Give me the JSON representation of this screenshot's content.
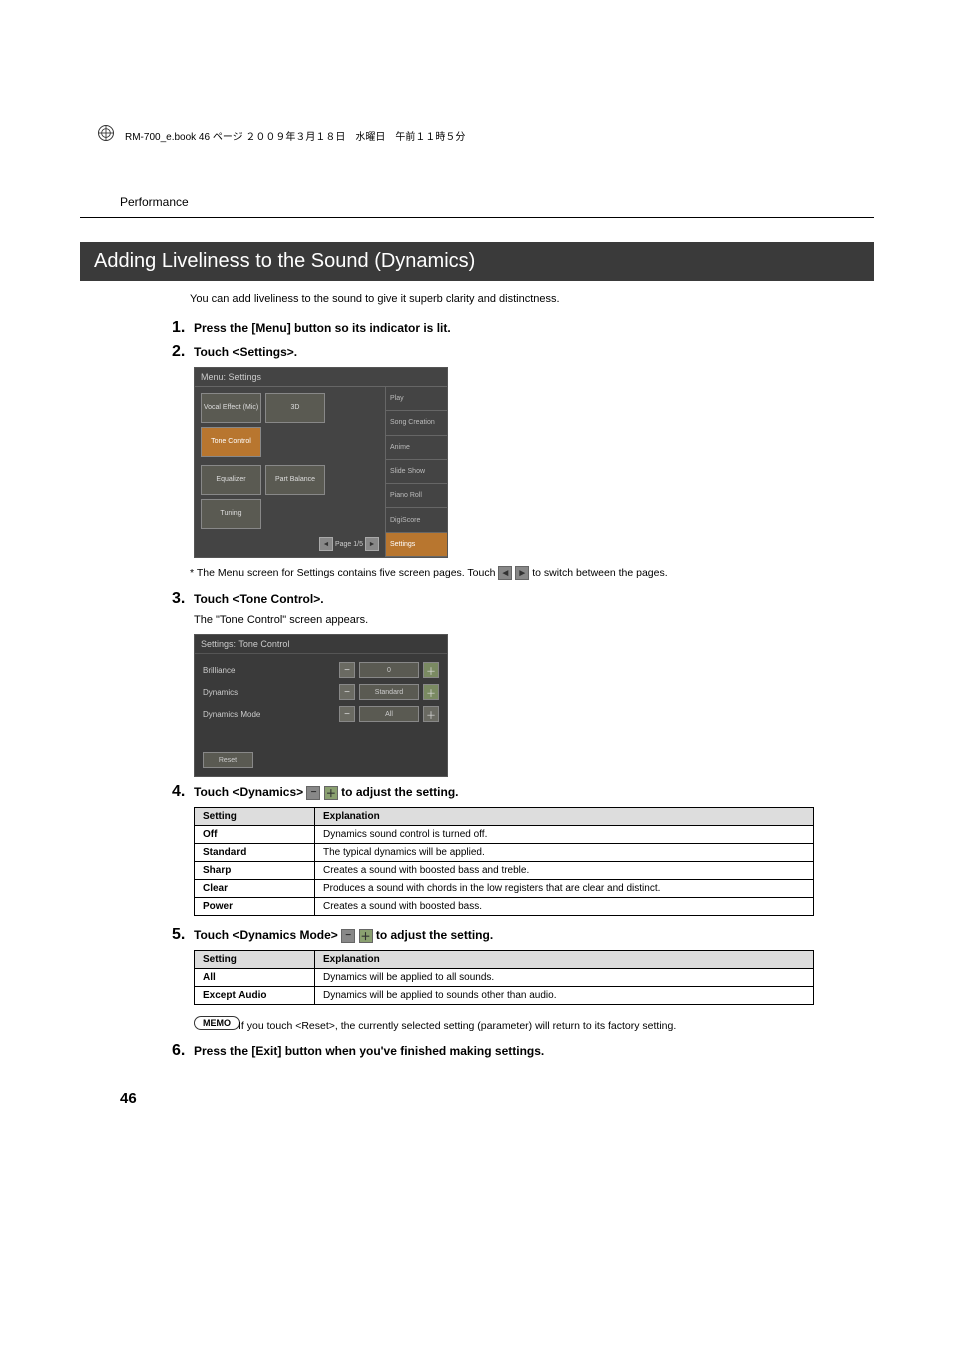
{
  "header_line": "RM-700_e.book  46 ページ  ２００９年３月１８日　水曜日　午前１１時５分",
  "section_label": "Performance",
  "title": "Adding Liveliness to the Sound (Dynamics)",
  "intro": "You can add liveliness to the sound to give it superb clarity and distinctness.",
  "steps": {
    "s1": {
      "num": "1.",
      "text": "Press the [Menu] button so its indicator is lit."
    },
    "s2": {
      "num": "2.",
      "text": "Touch <Settings>."
    },
    "s3": {
      "num": "3.",
      "text": "Touch <Tone Control>."
    },
    "s4": {
      "num": "4.",
      "pre": "Touch <Dynamics> ",
      "post": " to adjust the setting."
    },
    "s5": {
      "num": "5.",
      "pre": "Touch <Dynamics Mode> ",
      "post": " to adjust the setting."
    },
    "s6": {
      "num": "6.",
      "text": "Press the [Exit] button when you've finished making settings."
    }
  },
  "note_pre": "*   The Menu screen for Settings contains five screen pages. Touch ",
  "note_post": " to switch between the pages.",
  "tone_appears": "The \"Tone Control\" screen appears.",
  "memo_label": "MEMO",
  "memo_text": "If you touch <Reset>, the currently selected setting (parameter) will return to its factory setting.",
  "page_num": "46",
  "ss_settings": {
    "title": "Menu: Settings",
    "cells": [
      "Vocal Effect (Mic)",
      "3D",
      "Tone Control",
      "Equalizer",
      "Part Balance",
      "Tuning"
    ],
    "page_label": "Page 1/5",
    "tabs": [
      "Play",
      "Song Creation",
      "Anime",
      "Slide Show",
      "Piano Roll",
      "DigiScore",
      "Settings"
    ]
  },
  "ss_tone": {
    "title": "Settings: Tone Control",
    "rows": [
      {
        "label": "Brilliance",
        "value": "0"
      },
      {
        "label": "Dynamics",
        "value": "Standard"
      },
      {
        "label": "Dynamics Mode",
        "value": "All"
      }
    ],
    "reset": "Reset"
  },
  "table1": {
    "headers": [
      "Setting",
      "Explanation"
    ],
    "rows": [
      [
        "Off",
        "Dynamics sound control is turned off."
      ],
      [
        "Standard",
        "The typical dynamics will be applied."
      ],
      [
        "Sharp",
        "Creates a sound with boosted bass and treble."
      ],
      [
        "Clear",
        "Produces a sound with chords in the low registers that are clear and distinct."
      ],
      [
        "Power",
        "Creates a sound with boosted bass."
      ]
    ]
  },
  "table2": {
    "headers": [
      "Setting",
      "Explanation"
    ],
    "rows": [
      [
        "All",
        "Dynamics will be applied to all sounds."
      ],
      [
        "Except Audio",
        "Dynamics will be applied to sounds other than audio."
      ]
    ]
  },
  "icons": {
    "minus": "−",
    "plus": "＋",
    "left": "◄",
    "right": "►"
  }
}
